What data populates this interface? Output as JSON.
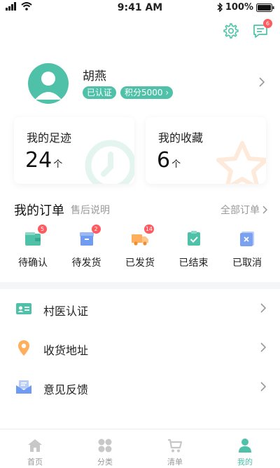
{
  "status_bar": {
    "time": "9:41 AM",
    "battery": "100%"
  },
  "header": {
    "message_count": "6"
  },
  "profile": {
    "name": "胡燕",
    "verified_label": "已认证",
    "points_label": "积分5000"
  },
  "stats": {
    "footprints": {
      "title": "我的足迹",
      "value": "24",
      "unit": "个"
    },
    "favorites": {
      "title": "我的收藏",
      "value": "6",
      "unit": "个"
    }
  },
  "orders": {
    "title": "我的订单",
    "note": "售后说明",
    "all_label": "全部订单",
    "items": [
      {
        "label": "待确认",
        "badge": "5",
        "color": "#4fc1a8"
      },
      {
        "label": "待发货",
        "badge": "2",
        "color": "#6f9bf2"
      },
      {
        "label": "已发货",
        "badge": "14",
        "color": "#ffae5c"
      },
      {
        "label": "已结束",
        "badge": "",
        "color": "#4fc1a8"
      },
      {
        "label": "已取消",
        "badge": "",
        "color": "#7aa0f2"
      }
    ]
  },
  "menu": {
    "items": [
      {
        "label": "村医认证",
        "icon": "id-card-icon"
      },
      {
        "label": "收货地址",
        "icon": "location-pin-icon"
      },
      {
        "label": "意见反馈",
        "icon": "mail-icon"
      }
    ]
  },
  "tabs": [
    {
      "label": "首页",
      "icon": "home-icon"
    },
    {
      "label": "分类",
      "icon": "category-icon"
    },
    {
      "label": "清单",
      "icon": "cart-icon"
    },
    {
      "label": "我的",
      "icon": "person-icon",
      "active": true
    }
  ],
  "colors": {
    "accent": "#4fc1a8",
    "badge": "#ff5a5f",
    "muted": "#999999"
  }
}
